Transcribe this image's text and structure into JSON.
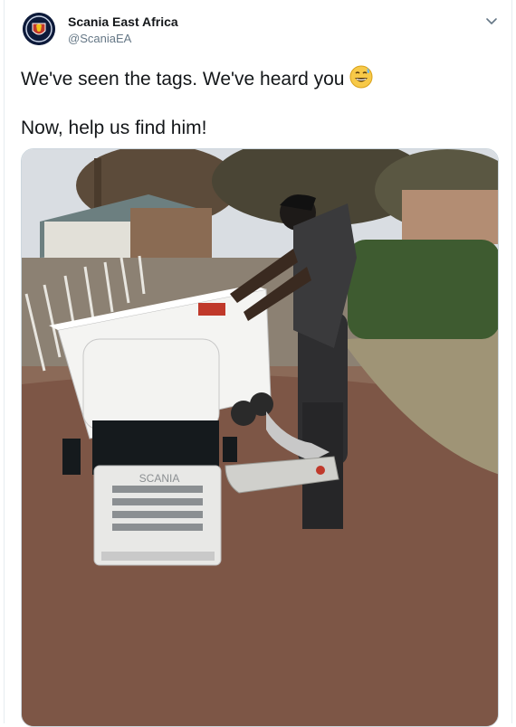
{
  "tweet": {
    "author_name": "Scania East Africa",
    "author_handle": "@ScaniaEA",
    "text_line1": "We've seen the tags. We've heard you",
    "text_line1_emoji": "grinning-face-with-sweat-emoji",
    "text_line2": "Now, help us find him!",
    "grille_brand": "SCANIA",
    "menu_icon": "chevron-down-icon",
    "avatar_icon": "scania-griffin-logo"
  },
  "colors": {
    "text": "#14171a",
    "secondary": "#657786",
    "border": "#e6ecf0",
    "avatar_bg": "#0d1a3a"
  }
}
